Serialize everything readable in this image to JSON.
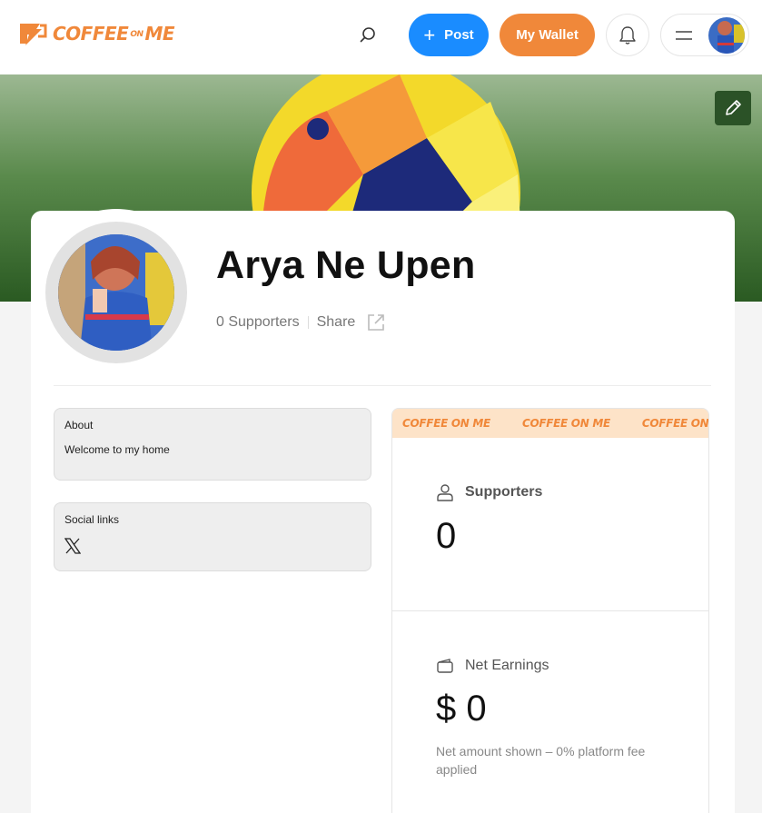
{
  "header": {
    "logo_text_main": "COFFEE",
    "logo_text_on": "ON",
    "logo_text_end": "ME",
    "post_label": "Post",
    "wallet_label": "My Wallet"
  },
  "profile": {
    "name": "Arya Ne Upen",
    "supporters_text": "0 Supporters",
    "share_label": "Share"
  },
  "about": {
    "title": "About",
    "text": "Welcome to my home"
  },
  "social": {
    "title": "Social links"
  },
  "ticker": [
    "COFFEE ON ME",
    "COFFEE ON ME",
    "COFFEE ON ME"
  ],
  "stats": {
    "supporters_label": "Supporters",
    "supporters_value": "0",
    "earnings_label": "Net Earnings",
    "earnings_value": "$ 0",
    "earnings_note": "Net amount shown – 0% platform fee applied"
  },
  "colors": {
    "brand_orange": "#f0883a",
    "post_blue": "#1a8cff",
    "ticker_bg": "#fde3c8"
  }
}
